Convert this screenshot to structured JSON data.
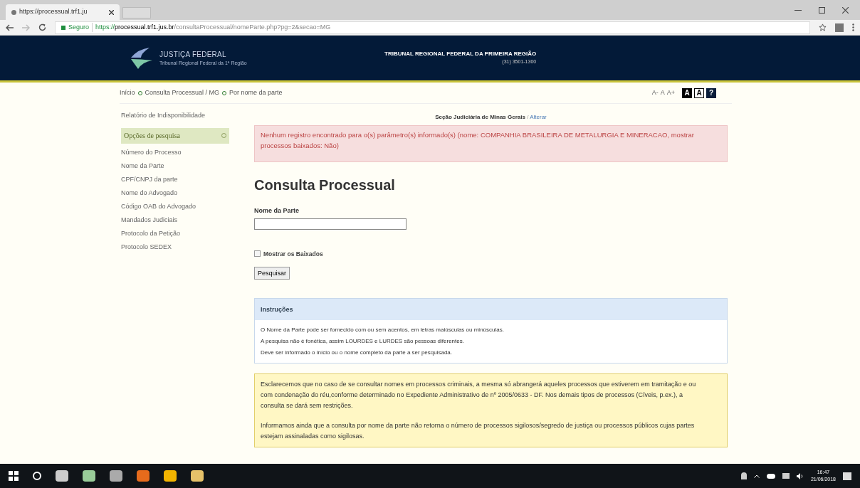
{
  "browser": {
    "tab_title": "https://processual.trf1.ju",
    "security": "Seguro",
    "url_host": "https://processual.trf1.jus.br",
    "url_path": "/consultaProcessual/nomeParte.php?pg=2&secao=MG"
  },
  "header": {
    "logo_title": "JUSTIÇA FEDERAL",
    "logo_subtitle": "Tribunal Regional Federal da 1ª Região",
    "court": "TRIBUNAL REGIONAL FEDERAL DA PRIMEIRA REGIÃO",
    "phone": "(31) 3501-1300"
  },
  "breadcrumb": [
    "Início",
    "Consulta Processual / MG",
    "Por nome da parte"
  ],
  "font_controls": [
    "A-",
    "A",
    "A+"
  ],
  "contrast_controls": [
    {
      "label": "A",
      "kind": "dark"
    },
    {
      "label": "A",
      "kind": "light"
    },
    {
      "label": "?",
      "kind": "help"
    }
  ],
  "sidebar": {
    "top_link": "Relatório de Indisponibilidade",
    "section_title": "Opções de pesquisa",
    "items": [
      "Número do Processo",
      "Nome da Parte",
      "CPF/CNPJ da parte",
      "Nome do Advogado",
      "Código OAB do Advogado",
      "Mandados Judiciais",
      "Protocolo da Petição",
      "Protocolo SEDEX"
    ]
  },
  "section": {
    "label": "Seção Judiciária de Minas Gerais",
    "separator": "/",
    "change_link": "Alterar"
  },
  "error": "Nenhum registro encontrado para o(s) parâmetro(s) informado(s) (nome: COMPANHIA BRASILEIRA DE METALURGIA E MINERACAO, mostrar processos baixados: Não)",
  "title": "Consulta Processual",
  "form": {
    "field_label": "Nome da Parte",
    "checkbox": {
      "label": "Mostrar os Baixados",
      "checked": false
    },
    "submit": "Pesquisar"
  },
  "instructions": {
    "title": "Instruções",
    "lines": [
      "O Nome da Parte pode ser fornecido com ou sem acentos, em letras maiúsculas ou minúsculas.",
      "A pesquisa não é fonética, assim LOURDES e LURDES são pessoas diferentes.",
      "Deve ser informado o início ou o nome completo da parte a ser pesquisada."
    ]
  },
  "notice": [
    "Esclarecemos que no caso de se consultar nomes em processos criminais, a mesma só abrangerá aqueles processos que estiverem em tramitação e ou com condenação do réu,conforme determinado no Expediente Administrativo de nº 2005/0633 - DF. Nos demais tipos de processos (Cíveis, p.ex.), a consulta se dará sem restrições.",
    "Informamos ainda que a consulta por nome da parte não retorna o número de processos sigilosos/segredo de justiça ou processos públicos cujas partes estejam assinaladas como sigilosas."
  ],
  "taskbar": {
    "time": "16:47",
    "date": "21/06/2018"
  }
}
